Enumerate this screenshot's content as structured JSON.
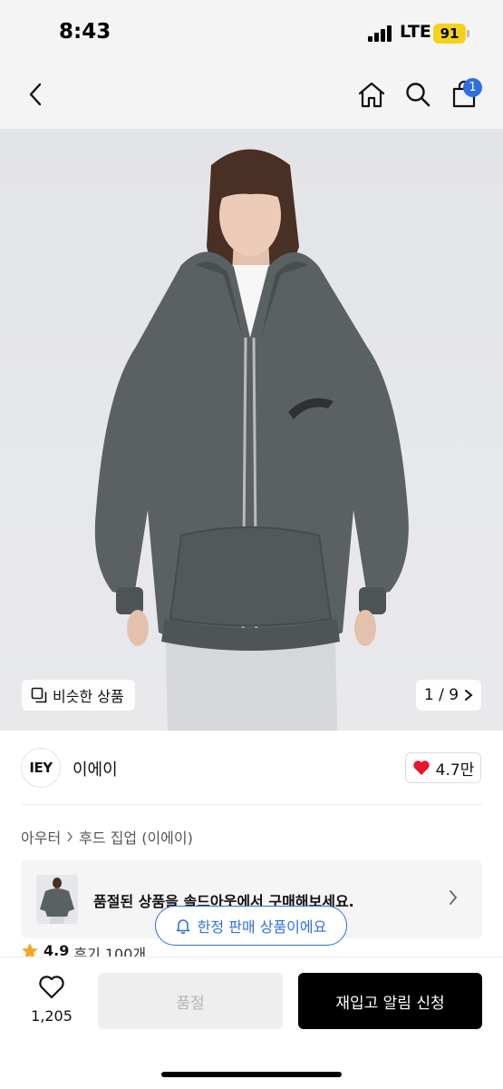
{
  "status_bar": {
    "time": "8:43",
    "network": "LTE",
    "battery": "91",
    "battery_color": "#f5d21a"
  },
  "nav": {
    "back_icon": "chevron-left-icon",
    "home_icon": "home-icon",
    "search_icon": "search-icon",
    "cart_icon": "shopping-bag-icon",
    "cart_badge": "1",
    "badge_color": "#2f6fe4"
  },
  "gallery": {
    "similar_label": "비슷한 상품",
    "similar_icon": "copy-icon",
    "current": "1",
    "total": "9",
    "pager_text": "1 / 9"
  },
  "brand": {
    "logo_text": "IEY",
    "name": "이에이",
    "likes": "4.7만",
    "heart_color": "#e6162d"
  },
  "breadcrumb": {
    "items": [
      "아우터",
      "후드 집업 (이에이)"
    ]
  },
  "soldout_banner": {
    "text": "품절된 상품을 솔드아웃에서 구매해보세요."
  },
  "limited_pill": {
    "text": "한정 판매 상품이에요",
    "icon": "bell-icon"
  },
  "rating": {
    "score": "4.9",
    "reviews": "후기 100개",
    "star_color": "#f5a623"
  },
  "bottom_bar": {
    "wish_count": "1,205",
    "soldout_label": "품절",
    "restock_label": "재입고 알림 신청"
  }
}
